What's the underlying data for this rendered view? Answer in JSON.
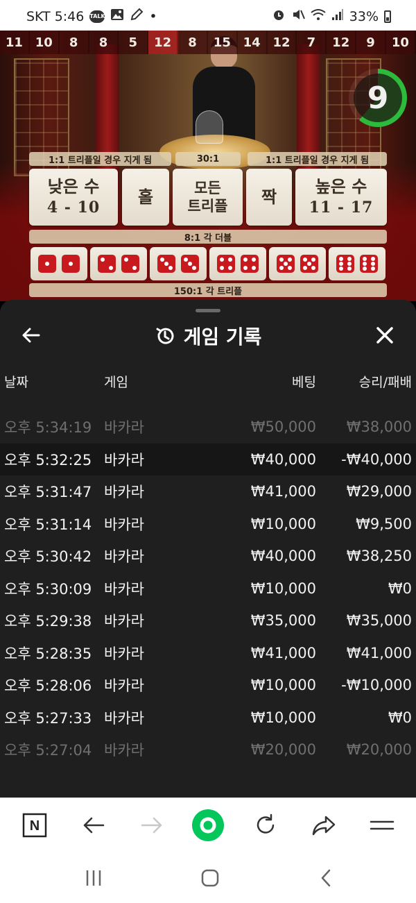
{
  "status_bar": {
    "carrier_time": "SKT 5:46",
    "talk_badge": "TALK",
    "dot": "•",
    "battery": "33%",
    "icons": [
      "kakaotalk-icon",
      "gallery-icon",
      "pencil-icon",
      "alarm-icon",
      "mute-icon",
      "wifi-icon",
      "signal-icon",
      "battery-icon"
    ]
  },
  "game": {
    "history": [
      "11",
      "10",
      "8",
      "8",
      "5",
      "12",
      "8",
      "15",
      "14",
      "12",
      "7",
      "12",
      "9",
      "10"
    ],
    "highlight_index": 5,
    "timer": "9",
    "timer_progress": 0.61,
    "payout_triple_loss_left": "1:1 트리플일 경우 지게 됨",
    "payout_30": "30:1",
    "payout_triple_loss_right": "1:1 트리플일 경우 지게 됨",
    "bets": {
      "low_label": "낮은 수",
      "low_range": "4 - 10",
      "odd": "홀",
      "any_triple_line1": "모든",
      "any_triple_line2": "트리플",
      "even": "짝",
      "high_label": "높은 수",
      "high_range": "11 - 17"
    },
    "double_payout": "8:1 각 더블",
    "doubles": [
      1,
      2,
      3,
      4,
      5,
      6
    ],
    "triple_payout": "150:1 각 트리플"
  },
  "sheet": {
    "title": "게임 기록",
    "columns": {
      "date": "날짜",
      "game": "게임",
      "bet": "베팅",
      "result": "승리/패배"
    },
    "rows": [
      {
        "time": "오후 5:34:19",
        "game": "바카라",
        "bet": "₩50,000",
        "result": "₩38,000"
      },
      {
        "time": "오후 5:32:25",
        "game": "바카라",
        "bet": "₩40,000",
        "result": "-₩40,000"
      },
      {
        "time": "오후 5:31:47",
        "game": "바카라",
        "bet": "₩41,000",
        "result": "₩29,000"
      },
      {
        "time": "오후 5:31:14",
        "game": "바카라",
        "bet": "₩10,000",
        "result": "₩9,500"
      },
      {
        "time": "오후 5:30:42",
        "game": "바카라",
        "bet": "₩40,000",
        "result": "₩38,250"
      },
      {
        "time": "오후 5:30:09",
        "game": "바카라",
        "bet": "₩10,000",
        "result": "₩0"
      },
      {
        "time": "오후 5:29:38",
        "game": "바카라",
        "bet": "₩35,000",
        "result": "₩35,000"
      },
      {
        "time": "오후 5:28:35",
        "game": "바카라",
        "bet": "₩41,000",
        "result": "₩41,000"
      },
      {
        "time": "오후 5:28:06",
        "game": "바카라",
        "bet": "₩10,000",
        "result": "-₩10,000"
      },
      {
        "time": "오후 5:27:33",
        "game": "바카라",
        "bet": "₩10,000",
        "result": "₩0"
      },
      {
        "time": "오후 5:27:04",
        "game": "바카라",
        "bet": "₩20,000",
        "result": "₩20,000"
      }
    ]
  },
  "toolbar": {
    "items": [
      "naver-n-icon",
      "back-arrow-icon",
      "forward-arrow-icon",
      "green-dot-icon",
      "refresh-icon",
      "share-icon",
      "menu-icon"
    ],
    "naver_letter": "N",
    "accent": "#03c75a"
  },
  "navbar": {
    "items": [
      "recent-apps-icon",
      "home-icon",
      "back-chevron-icon"
    ]
  }
}
